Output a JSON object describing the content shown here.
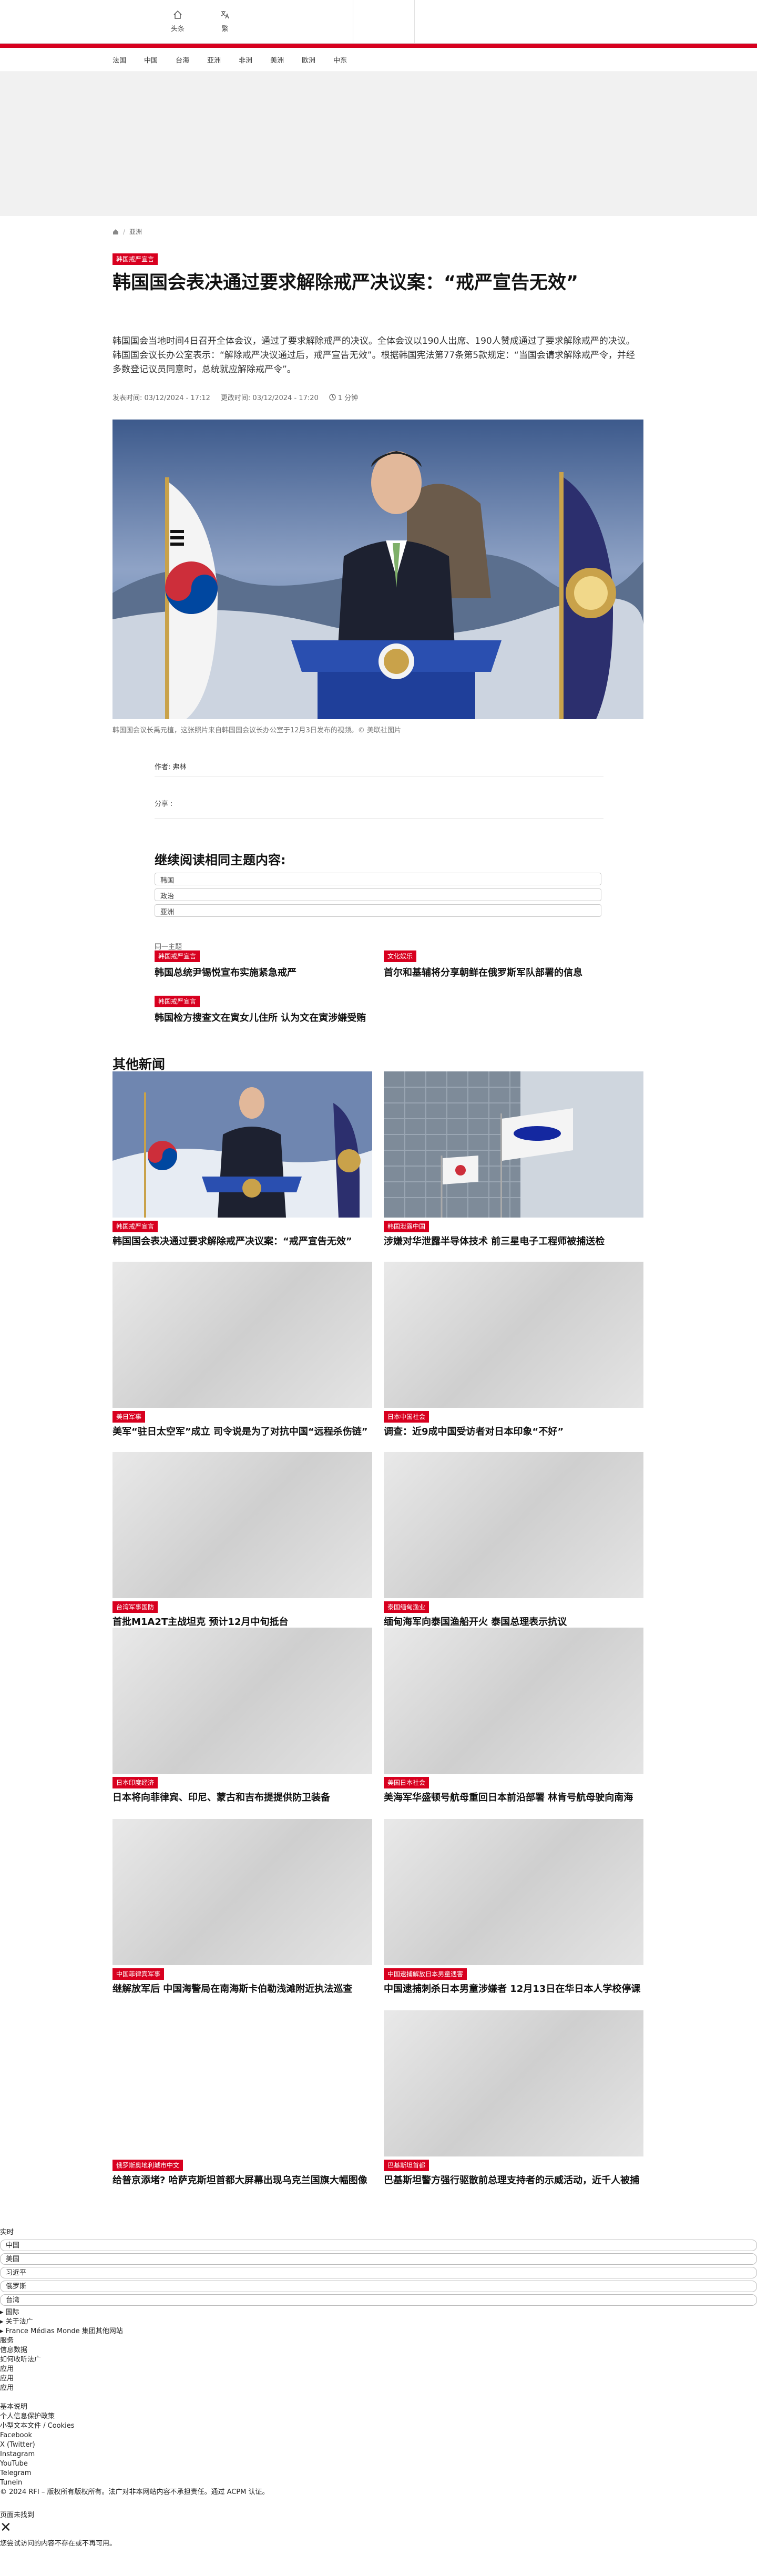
{
  "topbar": {
    "home_label": "头条",
    "lang_label": "繁"
  },
  "nav": {
    "items": [
      "法国",
      "中国",
      "台海",
      "亚洲",
      "非洲",
      "美洲",
      "欧洲",
      "中东"
    ]
  },
  "breadcrumb": {
    "section": "亚洲"
  },
  "article": {
    "tag": "韩国戒严宣言",
    "title": "韩国国会表决通过要求解除戒严决议案：“戒严宣告无效”",
    "lede": "韩国国会当地时间4日召开全体会议，通过了要求解除戒严的决议。全体会议以190人出席、190人赞成通过了要求解除戒严的决议。韩国国会议长办公室表示：“解除戒严决议通过后，戒严宣告无效”。根据韩国宪法第77条第5款规定：“当国会请求解除戒严令，并经多数登记议员同意时，总统就应解除戒严令”。",
    "published_label": "发表时间:",
    "published": "03/12/2024 - 17:12",
    "updated_label": "更改时间:",
    "updated": "03/12/2024 - 17:20",
    "read_time": "1 分钟",
    "caption": "韩国国会议长禹元植，这张照片来自韩国国会议长办公室于12月3日发布的视频。© 美联社图片",
    "author_label": "作者:",
    "author": "弗林",
    "share_label": "分享 :"
  },
  "read_more": {
    "heading": "继续阅读相同主题内容:",
    "keywords": [
      "韩国",
      "政治",
      "亚洲"
    ],
    "related_label": "同一主题"
  },
  "related": [
    {
      "tag": "韩国戒严宣言",
      "title": "韩国总统尹锡悦宣布实施紧急戒严"
    },
    {
      "tag": "文化娱乐",
      "title": "首尔和基辅将分享朝鲜在俄罗斯军队部署的信息"
    },
    {
      "tag": "韩国戒严宣言",
      "title": "韩国检方搜查文在寅女儿住所 认为文在寅涉嫌受贿"
    }
  ],
  "other_news": {
    "heading": "其他新闻",
    "cards": [
      {
        "tag": "韩国戒严宣言",
        "title": "韩国国会表决通过要求解除戒严决议案：“戒严宣告无效”"
      },
      {
        "tag": "韩国泄露中国",
        "title": "涉嫌对华泄露半导体技术 前三星电子工程师被捕送检"
      },
      {
        "tag": "美日军事",
        "title": "美军“驻日太空军”成立 司令说是为了对抗中国“远程杀伤链”"
      },
      {
        "tag": "日本中国社会",
        "title": "调查：近9成中国受访者对日本印象“不好”"
      },
      {
        "tag": "台湾军事国防",
        "title": "首批M1A2T主战坦克 预计12月中旬抵台"
      },
      {
        "tag": "泰国缅甸渔业",
        "title": "缅甸海军向泰国渔船开火 泰国总理表示抗议"
      },
      {
        "tag": "日本印度经济",
        "title": "日本将向菲律宾、印尼、蒙古和吉布提提供防卫装备"
      },
      {
        "tag": "美国日本社会",
        "title": "美海军华盛顿号航母重回日本前沿部署 林肯号航母驶向南海"
      },
      {
        "tag": "中国菲律宾军事",
        "title": "继解放军后 中国海警局在南海斯卡伯勒浅滩附近执法巡查"
      },
      {
        "tag": "中国逮捕解放日本男童遇害",
        "title": "中国逮捕刺杀日本男童涉嫌者 12月13日在华日本人学校停课"
      },
      {
        "tag": "俄罗斯奥地利城市中文",
        "title": "给普京添堵? 哈萨克斯坦首都大屏幕出现乌克兰国旗大幅图像"
      },
      {
        "tag": "巴基斯坦首都",
        "title": "巴基斯坦警方强行驱散前总理支持者的示威活动，近千人被捕"
      }
    ]
  },
  "footer": {
    "realtime": "实时",
    "lang_options": [
      "中国",
      "美国",
      "习近平",
      "俄罗斯",
      "台湾"
    ],
    "links": [
      "▸ 国际",
      "▸ 关于法广",
      "▸ France Médias Monde 集团其他网站",
      "服务",
      "信息数据",
      "如何收听法广",
      "应用",
      "应用",
      "应用"
    ],
    "legal_heading": "基本说明",
    "legal": [
      "个人信息保护政策",
      "小型文本文件 / Cookies",
      "Facebook",
      "X (Twitter)",
      "Instagram",
      "YouTube",
      "Telegram",
      "Tunein"
    ],
    "copyright": "© 2024 RFI – 版权所有版权所有。法广对非本网站内容不承担责任。通过 ACPM 认证。",
    "notfound_title": "页面未找到",
    "close_symbol": "✕",
    "notfound_text": "您尝试访问的内容不存在或不再可用。"
  },
  "colors": {
    "accent": "#d8001f"
  }
}
